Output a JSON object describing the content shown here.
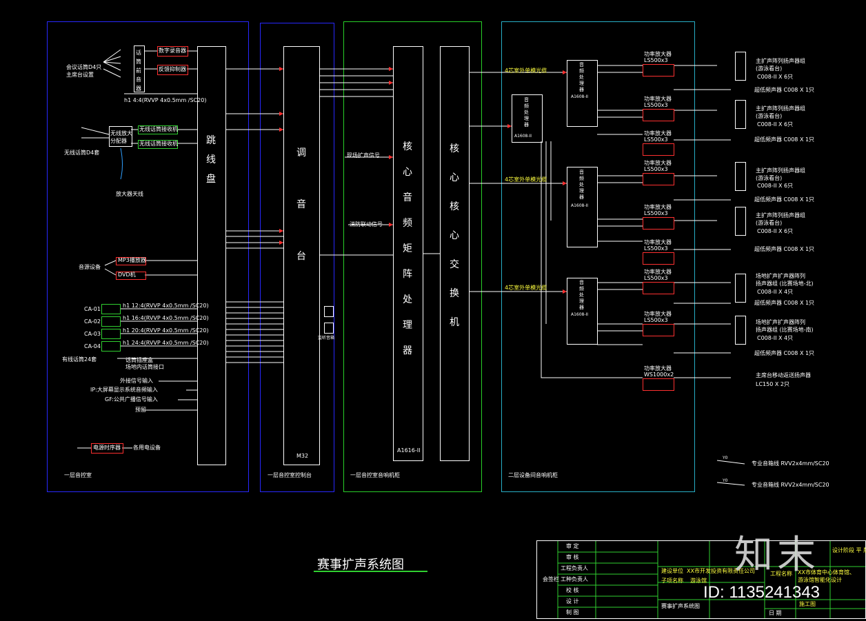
{
  "sections": {
    "room1_label": "一层音控室",
    "console_label": "一层音控室控制台",
    "rack1_label": "一层音控室音响机柜",
    "rack2_label": "二层设备间音响机柜"
  },
  "left": {
    "meeting_mic": "会议话筒D4只\n主席台设置",
    "mixer_stack": "话筒前音器",
    "digital_recorder": "数字录音器",
    "feedback": "反馈抑制器",
    "cable1": "h1 4:4(RVVP 4x0.5mm /SC20)",
    "wireless_mic": "无线话筒D4套",
    "wireless_amp": "无线放大\n分配器",
    "wireless_rx1": "无线话筒接收机",
    "wireless_rx2": "无线话筒接收机",
    "antenna": "放大器天线",
    "source": "音源设备",
    "mp3": "MP3播放器",
    "dvd": "DVD机",
    "ch1": "CA-01",
    "ch2": "CA-02",
    "ch3": "CA-03",
    "ch4": "CA-04",
    "cable_ca1": "h1 12:4(RVVP 4x0.5mm /SC20)",
    "cable_ca2": "h1 16:4(RVVP 4x0.5mm /SC20)",
    "cable_ca3": "h1 20:4(RVVP 4x0.5mm /SC20)",
    "cable_ca4": "h1 24:4(RVVP 4x0.5mm /SC20)",
    "field_mic": "有线话筒24套",
    "mic_box": "话筒插座盒\n场地内话筒接口",
    "ext_in": "外接信号输入",
    "ip_in": "IP:大屏幕显示系统音频输入",
    "gf_in": "GF:公共广播信号输入",
    "reserve": "预留",
    "power_seq": "电源时序器",
    "power_use": "各用电设备",
    "patch_panel": "跳线盘"
  },
  "console": {
    "name": "调音台",
    "model": "M32",
    "monitor": "监听音箱"
  },
  "rack1": {
    "signal1": "现场扩声信号",
    "signal2": "消防联动信号",
    "matrix": "核心音频矩阵处理器",
    "matrix_model": "A1616-II",
    "switch": "核心核心交换机"
  },
  "rack2": {
    "fiber1": "4芯室外单模光缆",
    "fiber2": "4芯室外单模光缆",
    "fiber3": "4芯室外单模光缆",
    "proc_main": "音频处理器",
    "proc_main_model": "A1608-II",
    "proc": "音频处理器",
    "proc_model": "A1608-II",
    "amp": "功率放大器",
    "amp_model": "LS500x3",
    "amp_last_model": "WS1000x2",
    "spk1": "主扩声阵列扬声器组\n(游泳看台)",
    "spk1_count": "C008-II X 6只",
    "spk2": "主扩声阵列扬声器组\n(游泳看台)",
    "spk2_count": "C008-II X 6只",
    "spk3": "主扩声阵列扬声器组\n(游泳看台)",
    "spk3_count": "C008-II X 6只",
    "spk4": "主扩声阵列扬声器组\n(游泳看台)",
    "spk4_count": "C008-II X 6只",
    "spk5": "场地扩声扩声器阵列\n扬声器组 (比赛场地-北)",
    "spk5_count": "C008-II X 4只",
    "spk6": "场地扩声扩声器阵列\n扬声器组 (比赛场地-南)",
    "spk6_count": "C008-II X 4只",
    "sub": "超低频声器  C008 X 1只",
    "monitor_spk": "主席台移动返送扬声器",
    "monitor_count": "LC150 X 2只",
    "cable_y": "专业音箱线 RVV2x4mm/SC20",
    "cable_y2": "专业音箱线 RVV2x4mm/SC20",
    "cable_y_code": "Y0",
    "cable_y2_code": "Y0"
  },
  "title": "赛事扩声系统图",
  "title_block": {
    "r1": "审 定",
    "r2": "审 核",
    "r3": "工程负责人",
    "r4": "工种负责人",
    "r5": "校 核",
    "r6": "设 计",
    "r7": "制 图",
    "left_col": "会签栏",
    "unit_label": "建设单位",
    "unit": "XX市开发投资有限责任公司",
    "sub_label": "子项名称",
    "sub": "游泳馆",
    "project_label": "工程名称",
    "project": "XX市体育中心体育馆、\n游泳馆智能化设计",
    "drawing": "赛事扩声系统图",
    "stage": "施工图",
    "phase": "设计阶段  平 版",
    "date_label": "日 期"
  },
  "watermark": {
    "logo": "知末",
    "id": "ID: 1135241343"
  }
}
